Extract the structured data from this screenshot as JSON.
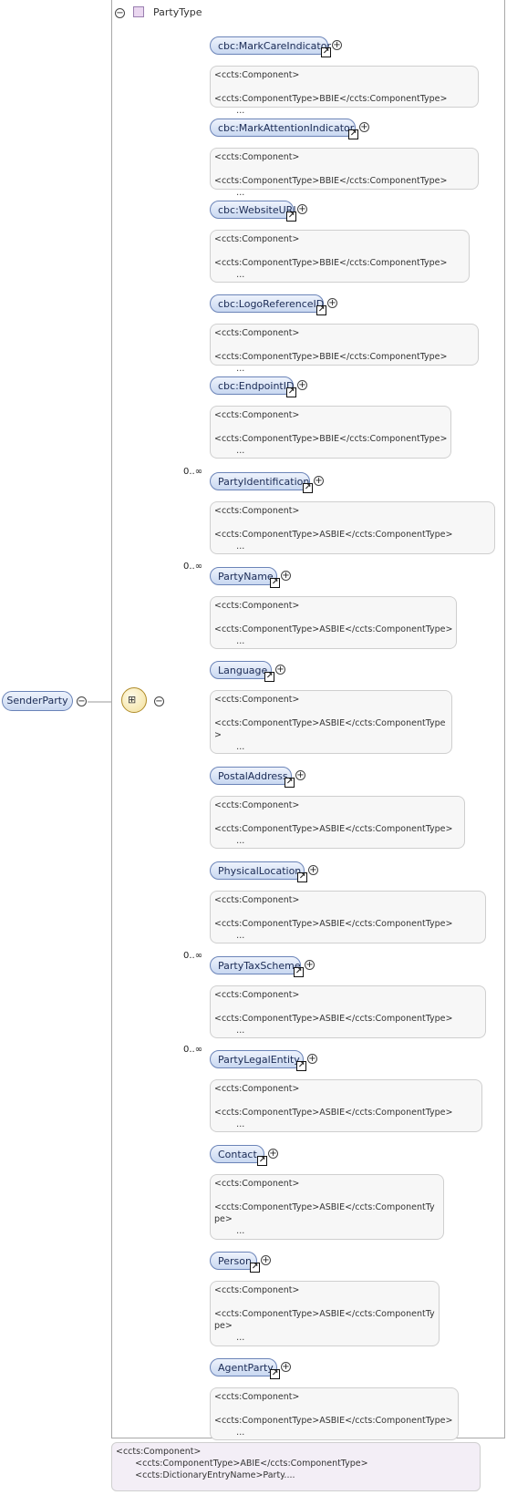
{
  "type_name": "PartyType",
  "root_element": "SenderParty",
  "bottom_annotation": "<ccts:Component>\n       <ccts:ComponentType>ABIE</ccts:ComponentType>\n       <ccts:DictionaryEntryName>Party....",
  "elements": [
    {
      "name": "cbc:MarkCareIndicator",
      "multiplicity": "",
      "annotation": "<ccts:Component>\n          <ccts:ComponentType>BBIE</ccts:ComponentType>\n        ..."
    },
    {
      "name": "cbc:MarkAttentionIndicator",
      "multiplicity": "",
      "annotation": "<ccts:Component>\n          <ccts:ComponentType>BBIE</ccts:ComponentType>\n        ..."
    },
    {
      "name": "cbc:WebsiteURI",
      "multiplicity": "",
      "annotation": "<ccts:Component>\n\n<ccts:ComponentType>BBIE</ccts:ComponentType>\n        ..."
    },
    {
      "name": "cbc:LogoReferenceID",
      "multiplicity": "",
      "annotation": "<ccts:Component>\n          <ccts:ComponentType>BBIE</ccts:ComponentType>\n        ..."
    },
    {
      "name": "cbc:EndpointID",
      "multiplicity": "",
      "annotation": "<ccts:Component>\n\n<ccts:ComponentType>BBIE</ccts:ComponentType>\n        ..."
    },
    {
      "name": "PartyIdentification",
      "multiplicity": "0..∞",
      "annotation": "<ccts:Component>\n\n<ccts:ComponentType>ASBIE</ccts:ComponentType>\n        ..."
    },
    {
      "name": "PartyName",
      "multiplicity": "0..∞",
      "annotation": "<ccts:Component>\n\n<ccts:ComponentType>ASBIE</ccts:ComponentType>\n        ..."
    },
    {
      "name": "Language",
      "multiplicity": "",
      "annotation": "<ccts:Component>\n\n<ccts:ComponentType>ASBIE</ccts:ComponentType\n>\n        ..."
    },
    {
      "name": "PostalAddress",
      "multiplicity": "",
      "annotation": "<ccts:Component>\n\n<ccts:ComponentType>ASBIE</ccts:ComponentType>\n        ..."
    },
    {
      "name": "PhysicalLocation",
      "multiplicity": "",
      "annotation": "<ccts:Component>\n\n<ccts:ComponentType>ASBIE</ccts:ComponentType>\n        ..."
    },
    {
      "name": "PartyTaxScheme",
      "multiplicity": "0..∞",
      "annotation": "<ccts:Component>\n\n<ccts:ComponentType>ASBIE</ccts:ComponentType>\n        ..."
    },
    {
      "name": "PartyLegalEntity",
      "multiplicity": "0..∞",
      "annotation": "<ccts:Component>\n\n<ccts:ComponentType>ASBIE</ccts:ComponentType>\n        ..."
    },
    {
      "name": "Contact",
      "multiplicity": "",
      "annotation": "<ccts:Component>\n\n<ccts:ComponentType>ASBIE</ccts:ComponentTy\npe>\n        ..."
    },
    {
      "name": "Person",
      "multiplicity": "",
      "annotation": "<ccts:Component>\n\n<ccts:ComponentType>ASBIE</ccts:ComponentTy\npe>\n        ..."
    },
    {
      "name": "AgentParty",
      "multiplicity": "",
      "annotation": "<ccts:Component>\n\n<ccts:ComponentType>ASBIE</ccts:ComponentType>\n        ..."
    }
  ]
}
